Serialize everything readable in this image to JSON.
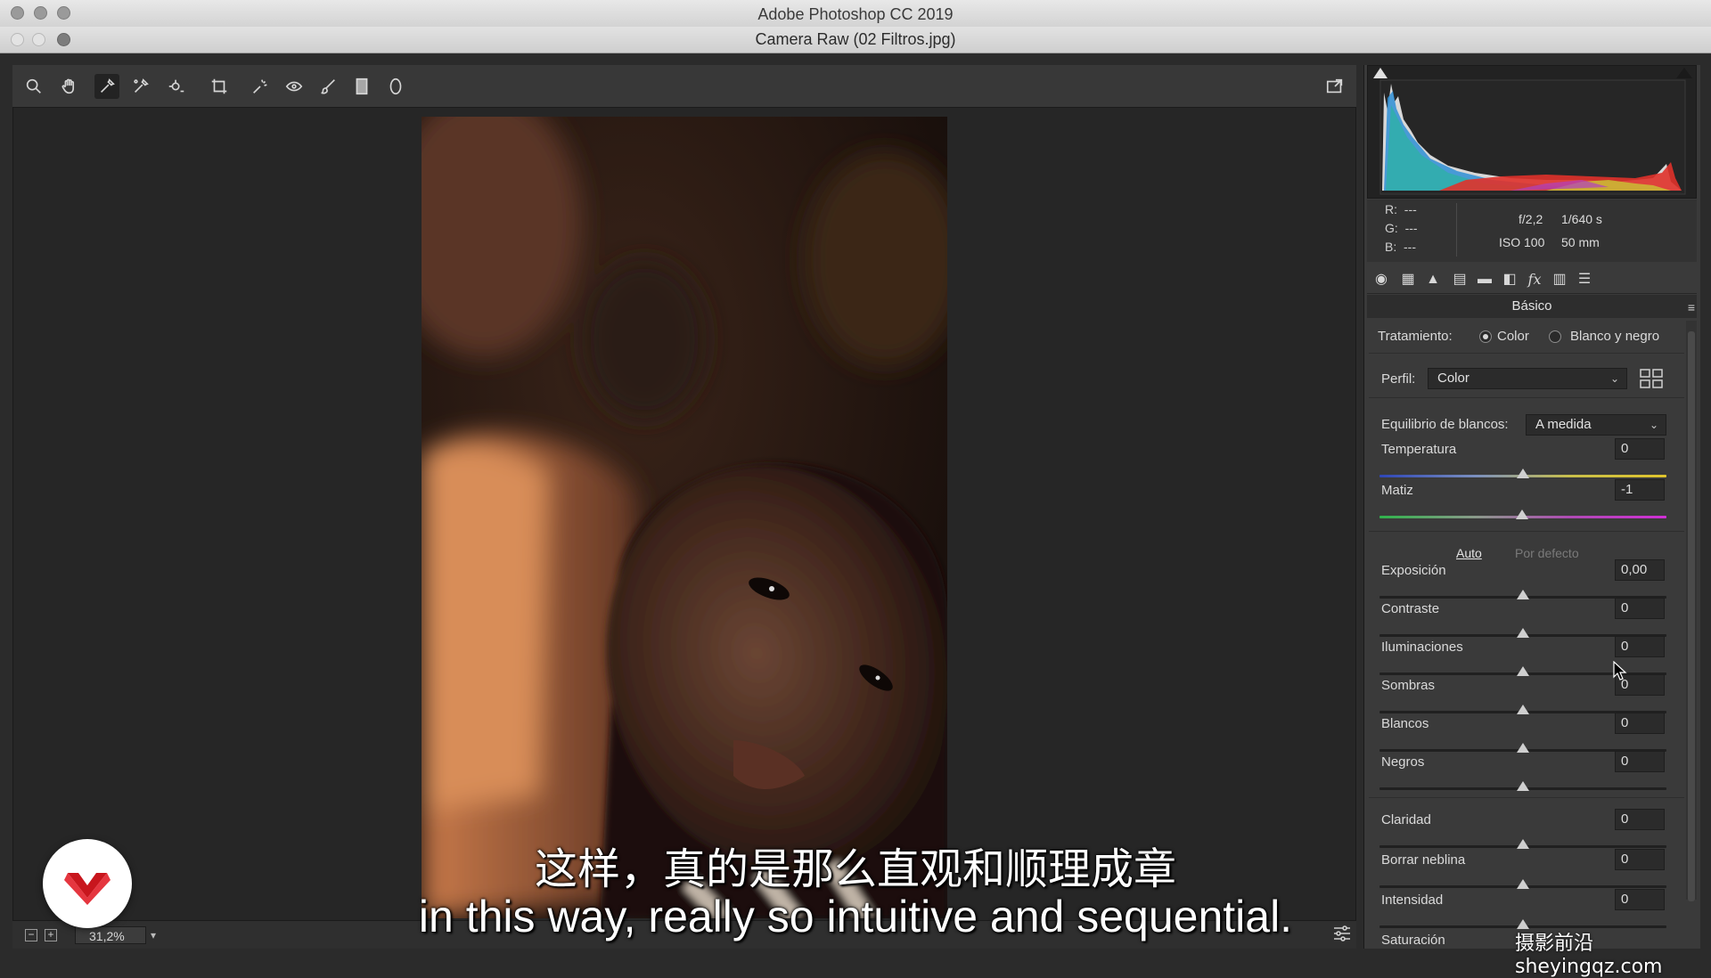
{
  "app_title": "Adobe Photoshop CC 2019",
  "document_title": "Camera Raw (02 Filtros.jpg)",
  "toolbar": {
    "tools": [
      "zoom-icon",
      "hand-icon",
      "white-balance-icon",
      "color-sampler-icon",
      "targeted-adjustment-icon",
      "crop-icon",
      "spot-removal-icon",
      "red-eye-icon",
      "adjustment-brush-icon",
      "graduated-filter-icon",
      "radial-filter-icon"
    ],
    "active_tool": "white-balance-icon",
    "right_icon": "open-preferences-icon"
  },
  "status_bar": {
    "zoom": "31,2%"
  },
  "info": {
    "r_label": "R:",
    "r_value": "---",
    "g_label": "G:",
    "g_value": "---",
    "b_label": "B:",
    "b_value": "---",
    "aperture": "f/2,2",
    "shutter": "1/640 s",
    "iso": "ISO 100",
    "focal": "50 mm"
  },
  "panel": {
    "title": "Básico",
    "treatment_label": "Tratamiento:",
    "treatment_color": "Color",
    "treatment_bw": "Blanco y negro",
    "profile_label": "Perfil:",
    "profile_value": "Color",
    "wb_label": "Equilibrio de blancos:",
    "wb_value": "A medida",
    "auto_label": "Auto",
    "default_label": "Por defecto",
    "sliders": [
      {
        "label": "Temperatura",
        "value": "0"
      },
      {
        "label": "Matiz",
        "value": "-1"
      },
      {
        "label": "Exposición",
        "value": "0,00"
      },
      {
        "label": "Contraste",
        "value": "0"
      },
      {
        "label": "Iluminaciones",
        "value": "0"
      },
      {
        "label": "Sombras",
        "value": "0"
      },
      {
        "label": "Blancos",
        "value": "0"
      },
      {
        "label": "Negros",
        "value": "0"
      },
      {
        "label": "Claridad",
        "value": "0"
      },
      {
        "label": "Borrar neblina",
        "value": "0"
      },
      {
        "label": "Intensidad",
        "value": "0"
      },
      {
        "label": "Saturación",
        "value": ""
      }
    ]
  },
  "subtitles": {
    "cn": "这样，真的是那么直观和顺理成章",
    "en": "in this way, really so intuitive and sequential."
  },
  "watermark": "摄影前沿 sheyingqz.com"
}
